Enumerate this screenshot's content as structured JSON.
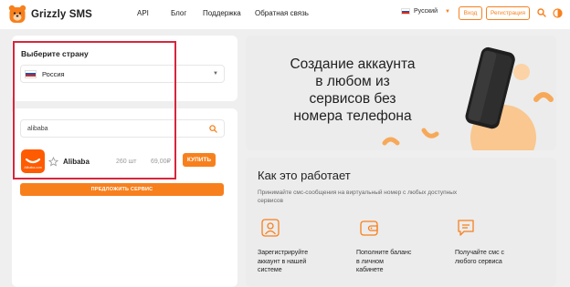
{
  "header": {
    "brand": "Grizzly SMS",
    "nav": [
      "API",
      "Блог",
      "Поддержка",
      "Обратная связь"
    ],
    "language": "Русский",
    "login": "Вход",
    "register": "Регистрация"
  },
  "country": {
    "title": "Выберите страну",
    "selected": "Россия"
  },
  "search": {
    "value": "alibaba"
  },
  "service": {
    "logo_text": "Alibaba.com",
    "name": "Alibaba",
    "count": "260 шт",
    "price": "69,00₽",
    "buy": "КУПИТЬ"
  },
  "suggest_button": "ПРЕДЛОЖИТЬ СЕРВИС",
  "hero": {
    "lines": [
      "Создание аккаунта",
      "в любом из",
      "сервисов без",
      "номера телефона"
    ]
  },
  "how": {
    "title": "Как это работает",
    "description": "Принимайте смс-сообщения на виртуальный номер с любых доступных сервисов",
    "steps": [
      {
        "lines": [
          "Зарегистрируйте",
          "аккаунт в нашей",
          "системе"
        ]
      },
      {
        "lines": [
          "Пополните баланс",
          "в личном",
          "кабинете"
        ]
      },
      {
        "lines": [
          "Получайте смс с",
          "любого сервиса"
        ]
      }
    ]
  },
  "colors": {
    "accent": "#f7801d",
    "highlight": "#d7263d"
  },
  "icons": [
    "bear-logo-icon",
    "flag-russia-icon",
    "chevron-down-icon",
    "search-icon",
    "theme-toggle-icon",
    "star-icon",
    "alibaba-logo-icon",
    "user-icon",
    "wallet-icon",
    "message-icon",
    "phone-illustration"
  ]
}
